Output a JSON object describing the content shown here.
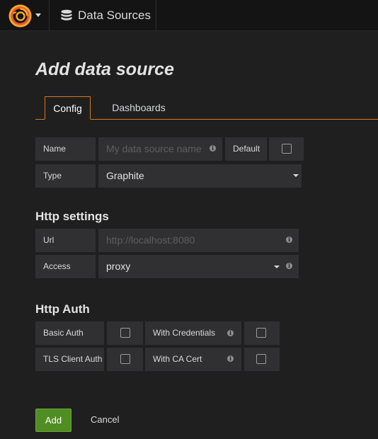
{
  "navbar": {
    "logo_icon": "grafana-logo-icon",
    "breadcrumb_icon": "database-icon",
    "breadcrumb": "Data Sources"
  },
  "page": {
    "title": "Add data source"
  },
  "tabs": [
    {
      "label": "Config",
      "active": true
    },
    {
      "label": "Dashboards",
      "active": false
    }
  ],
  "form": {
    "name": {
      "label": "Name",
      "placeholder": "My data source name",
      "value": ""
    },
    "default": {
      "label": "Default",
      "checked": false
    },
    "type": {
      "label": "Type",
      "value": "Graphite"
    }
  },
  "http_settings": {
    "title": "Http settings",
    "url": {
      "label": "Url",
      "placeholder": "http://localhost:8080",
      "value": ""
    },
    "access": {
      "label": "Access",
      "value": "proxy"
    }
  },
  "http_auth": {
    "title": "Http Auth",
    "basic_auth": {
      "label": "Basic Auth",
      "checked": false
    },
    "with_credentials": {
      "label": "With Credentials",
      "checked": false
    },
    "tls_client_auth": {
      "label": "TLS Client Auth",
      "checked": false
    },
    "with_ca_cert": {
      "label": "With CA Cert",
      "checked": false
    }
  },
  "actions": {
    "add_label": "Add",
    "cancel_label": "Cancel"
  },
  "colors": {
    "accent_orange": "#d17b1e",
    "add_button_green": "#508d23",
    "background": "#1f1f20",
    "navbar": "#141414"
  }
}
